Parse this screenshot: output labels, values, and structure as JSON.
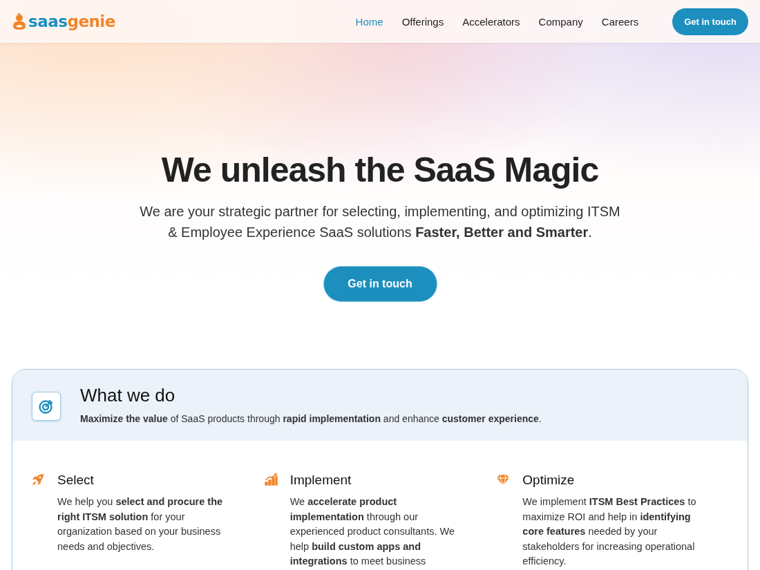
{
  "logo": {
    "part_1": "saas",
    "part_2": "genie"
  },
  "nav": [
    {
      "label": "Home",
      "selected": true
    },
    {
      "label": "Offerings",
      "selected": false
    },
    {
      "label": "Accelerators",
      "selected": false
    },
    {
      "label": "Company",
      "selected": false
    },
    {
      "label": "Careers",
      "selected": false
    }
  ],
  "header_button": "Get in touch",
  "hero": {
    "title": "We unleash the SaaS Magic",
    "subtitle": "We are your strategic partner for selecting, implementing, and optimizing ITSM &  Employee Experience SaaS solutions **Faster, Better and Smarter**.",
    "button": "Get in touch"
  },
  "what_we_do": {
    "title": "What we do",
    "text": "**Maximize the value** of SaaS products through **rapid implementation** and enhance **customer experience**.",
    "services": [
      {
        "kind": "rocket",
        "title": "Select",
        "text": "We help you **select and procure the right ITSM solution** for your organization based on your business needs and objectives."
      },
      {
        "kind": "chart",
        "title": "Implement",
        "text": "We **accelerate product implementation** through our experienced product consultants. We help **build custom apps and integrations** to meet business"
      },
      {
        "kind": "diamond",
        "title": "Optimize",
        "text": "We implement **ITSM Best Practices** to maximize ROI and help in **identifying core features** needed by your stakeholders for increasing operational efficiency."
      }
    ]
  }
}
